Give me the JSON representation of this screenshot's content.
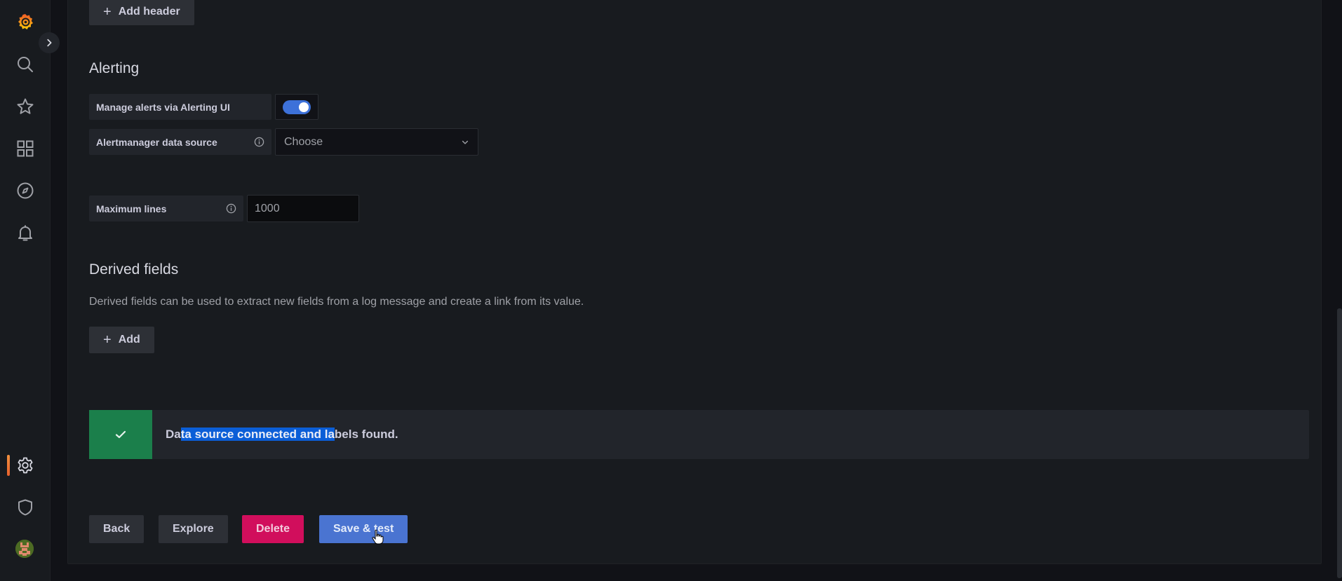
{
  "sidebar": {
    "logo": "grafana-logo-icon",
    "expand_toggle": "chevron-right-icon",
    "items": [
      {
        "name": "search",
        "icon": "search-icon"
      },
      {
        "name": "starred",
        "icon": "star-icon"
      },
      {
        "name": "dashboards",
        "icon": "apps-icon"
      },
      {
        "name": "explore",
        "icon": "compass-icon"
      },
      {
        "name": "alerting",
        "icon": "bell-icon"
      }
    ],
    "bottom_items": [
      {
        "name": "configuration",
        "icon": "gear-icon",
        "active": true
      },
      {
        "name": "server-admin",
        "icon": "shield-icon"
      },
      {
        "name": "profile",
        "icon": "avatar"
      }
    ],
    "active_accent": "#f55f3e"
  },
  "http_headers": {
    "add_header_label": "Add header"
  },
  "alerting": {
    "title": "Alerting",
    "manage_alerts_label": "Manage alerts via Alerting UI",
    "manage_alerts_enabled": true,
    "alertmanager_label": "Alertmanager data source",
    "alertmanager_placeholder": "Choose"
  },
  "max_lines": {
    "label": "Maximum lines",
    "value": "1000"
  },
  "derived_fields": {
    "title": "Derived fields",
    "description": "Derived fields can be used to extract new fields from a log message and create a link from its value.",
    "add_label": "Add"
  },
  "status_alert": {
    "icon": "check-icon",
    "text_before_selection": "Da",
    "text_selected": "ta source connected and la",
    "text_after_selection": "bels found.",
    "color": "#1b7f4b"
  },
  "actions": {
    "back": "Back",
    "explore": "Explore",
    "delete": "Delete",
    "save_test": "Save & test"
  }
}
